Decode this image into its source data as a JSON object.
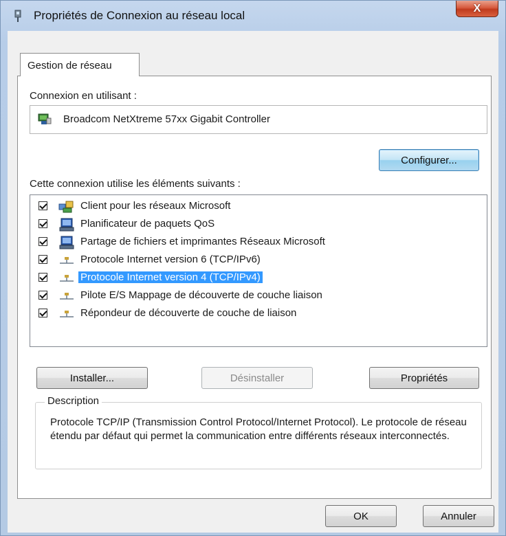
{
  "window": {
    "title": "Propriétés de Connexion au réseau local",
    "close_label": "X"
  },
  "tab": {
    "label": "Gestion de réseau"
  },
  "connect_using": {
    "label": "Connexion en utilisant :",
    "adapter": "Broadcom NetXtreme 57xx Gigabit Controller",
    "configure_label": "Configurer..."
  },
  "items_section": {
    "label": "Cette connexion utilise les éléments suivants :",
    "items": [
      {
        "label": "Client pour les réseaux Microsoft",
        "icon": "network-client-icon",
        "checked": true
      },
      {
        "label": "Planificateur de paquets QoS",
        "icon": "service-icon",
        "checked": true
      },
      {
        "label": "Partage de fichiers et imprimantes Réseaux Microsoft",
        "icon": "service-icon",
        "checked": true
      },
      {
        "label": "Protocole Internet version 6 (TCP/IPv6)",
        "icon": "protocol-icon",
        "checked": true
      },
      {
        "label": "Protocole Internet version 4 (TCP/IPv4)",
        "icon": "protocol-icon",
        "checked": true,
        "selected": true
      },
      {
        "label": "Pilote E/S Mappage de découverte de couche liaison",
        "icon": "protocol-icon",
        "checked": true
      },
      {
        "label": "Répondeur de découverte de couche de liaison",
        "icon": "protocol-icon",
        "checked": true
      }
    ]
  },
  "buttons": {
    "install": "Installer...",
    "uninstall": "Désinstaller",
    "properties": "Propriétés",
    "ok": "OK",
    "cancel": "Annuler"
  },
  "description": {
    "legend": "Description",
    "text": "Protocole TCP/IP (Transmission Control Protocol/Internet Protocol). Le protocole de réseau étendu par défaut qui permet la communication entre différents réseaux interconnectés."
  },
  "colors": {
    "selection": "#3399ff",
    "title_gradient": "#b7cde8",
    "close_button": "#c03b1e"
  }
}
